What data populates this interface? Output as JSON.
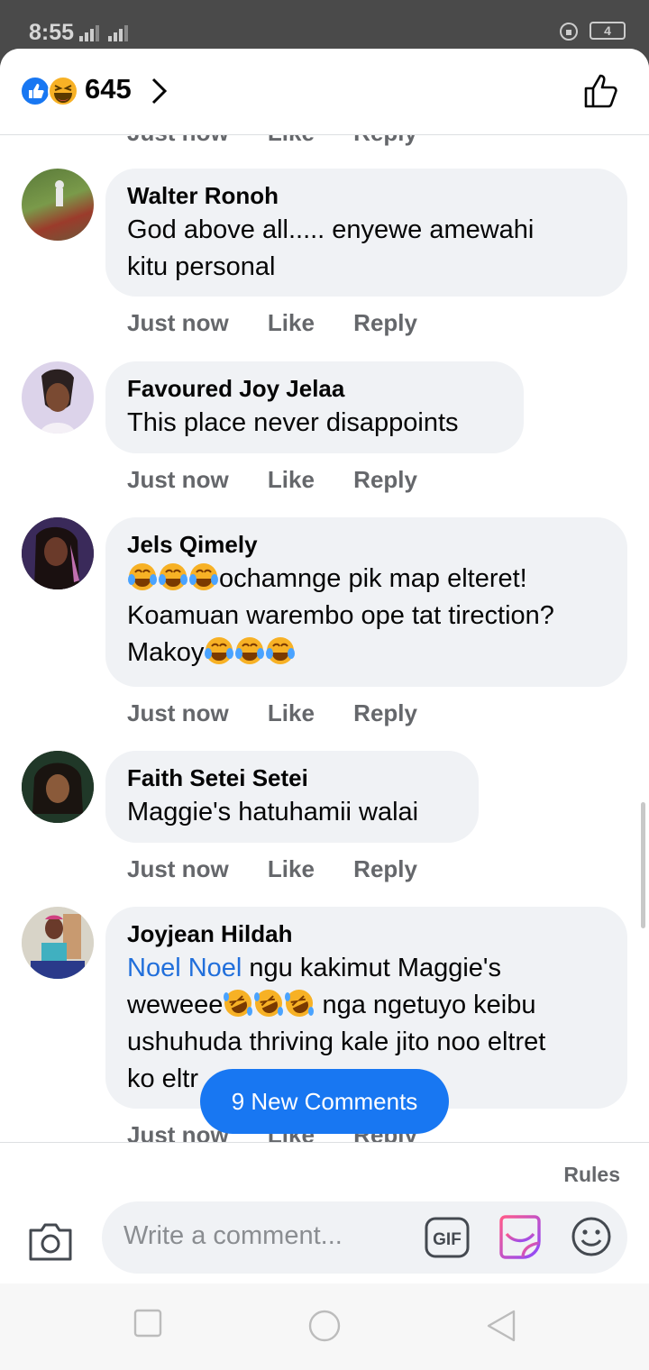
{
  "status_bar": {
    "time": "8:55",
    "battery": "4"
  },
  "reactions": {
    "count": "645"
  },
  "comments": [
    {
      "author": "Walter Ronoh",
      "text_parts": [
        "God above all..... enyewe amewahi",
        "kitu personal"
      ],
      "time": "Just now",
      "like": "Like",
      "reply": "Reply"
    },
    {
      "author": "Favoured Joy Jelaa",
      "text_parts": [
        "This place never disappoints"
      ],
      "time": "Just now",
      "like": "Like",
      "reply": "Reply"
    },
    {
      "author": "Jels Qimely",
      "line1": "ochamnge pik map elteret!",
      "line2": "Koamuan warembo ope tat tirection?",
      "line3": "Makoy",
      "time": "Just now",
      "like": "Like",
      "reply": "Reply"
    },
    {
      "author": "Faith Setei Setei",
      "text_parts": [
        "Maggie's hatuhamii walai"
      ],
      "time": "Just now",
      "like": "Like",
      "reply": "Reply"
    },
    {
      "author": "Joyjean Hildah",
      "mention": "Noel Noel",
      "line1": " ngu kakimut Maggie's",
      "line2a": "weweee",
      "line2b": " nga ngetuyo keibu",
      "line3": "ushuhuda thriving kale jito noo eltret",
      "line4": "ko eltr",
      "time": "Just now",
      "like": "Like",
      "reply": "Reply"
    }
  ],
  "ghost_actions": {
    "time": "Just now",
    "like": "Like",
    "reply": "Reply"
  },
  "new_comments_label": "9 New Comments",
  "footer": {
    "rules": "Rules",
    "input_placeholder": "Write a comment..."
  },
  "icons": [
    "like-reaction-icon",
    "haha-reaction-icon",
    "chevron-right-icon",
    "thumbs-up-outline-icon",
    "camera-icon",
    "gif-icon",
    "sticker-icon",
    "smiley-icon",
    "tears-of-joy-emoji",
    "rofl-emoji"
  ],
  "colors": {
    "accent": "#1877f2",
    "bubble": "#f0f2f5",
    "mention": "#216fdb",
    "meta": "#65676b"
  }
}
